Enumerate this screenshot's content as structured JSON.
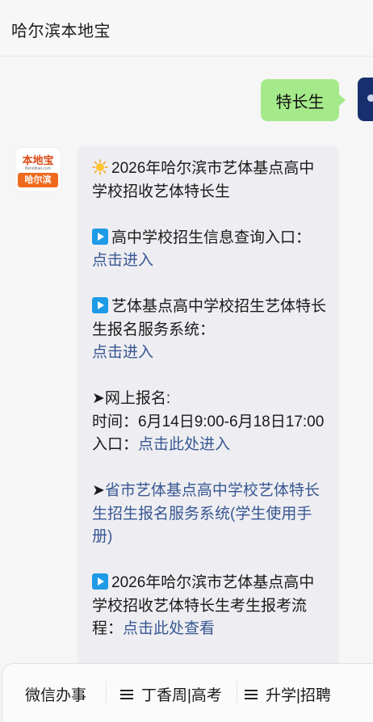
{
  "header": {
    "title": "哈尔滨本地宝"
  },
  "outgoing": {
    "text": "特长生"
  },
  "bot_avatar": {
    "logo_top": "本地宝",
    "logo_sub": "Bendibao.com",
    "logo_city": "哈尔滨"
  },
  "message": {
    "intro": "2026年哈尔滨市艺体基点高中学校招收艺体特长生",
    "item1_text": "高中学校招生信息查询入口：",
    "item1_link": "点击进入",
    "item2_text": "艺体基点高中学校招生艺体特长生报名服务系统：",
    "item2_link": "点击进入",
    "online_title": "➤网上报名:",
    "online_time": "时间：6月14日9:00-6月18日17:00",
    "online_entry_label": "入口：",
    "online_entry_link": "点击此处进入",
    "manual_arrow": "➤",
    "manual_link": "省市艺体基点高中学校艺体特长生招生报名服务系统(学生使用手册)",
    "item3_text": "2026年哈尔滨市艺体基点高中学校招收艺体特长生考生报考流程：",
    "item3_link": "点击此处查看"
  },
  "menu": {
    "items": [
      {
        "label": "微信办事"
      },
      {
        "label": "丁香周|高考"
      },
      {
        "label": "升学|招聘"
      }
    ]
  },
  "colors": {
    "outgoing_bubble": "#a5ea8a",
    "link": "#385792",
    "play_icon": "#1e9be6"
  }
}
